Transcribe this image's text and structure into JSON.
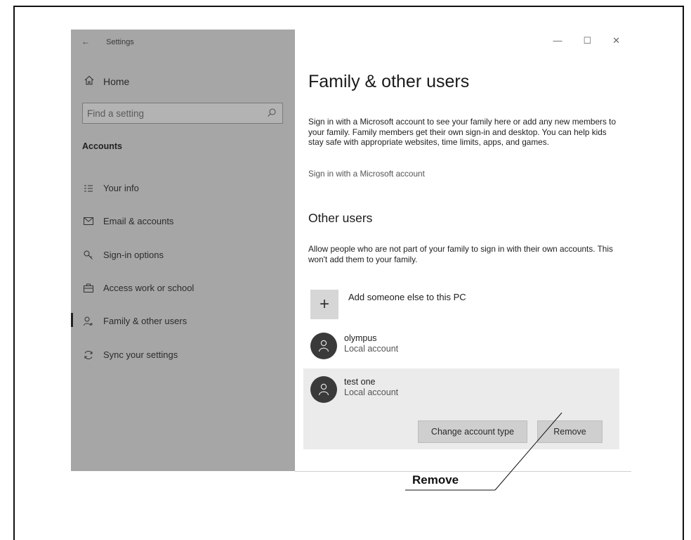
{
  "window": {
    "title": "Settings",
    "controls": {
      "minimize": "—",
      "maximize": "☐",
      "close": "✕"
    }
  },
  "sidebar": {
    "home_label": "Home",
    "search_placeholder": "Find a setting",
    "section_title": "Accounts",
    "items": [
      {
        "label": "Your info",
        "icon": "your-info-icon"
      },
      {
        "label": "Email & accounts",
        "icon": "email-icon"
      },
      {
        "label": "Sign-in options",
        "icon": "key-icon"
      },
      {
        "label": "Access work or school",
        "icon": "briefcase-icon"
      },
      {
        "label": "Family & other users",
        "icon": "person-add-icon",
        "active": true
      },
      {
        "label": "Sync your settings",
        "icon": "sync-icon"
      }
    ]
  },
  "main": {
    "title": "Family & other users",
    "description": "Sign in with a Microsoft account to see your family here or add any new members to your family. Family members get their own sign-in and desktop. You can help kids stay safe with appropriate websites, time limits, apps, and games.",
    "signin_link": "Sign in with a Microsoft account",
    "other_users_title": "Other users",
    "other_users_description": "Allow people who are not part of your family to sign in with their own accounts. This won't add them to your family.",
    "add_user_label": "Add someone else to this PC",
    "users": [
      {
        "name": "olympus",
        "type": "Local account"
      },
      {
        "name": "test one",
        "type": "Local account",
        "selected": true
      }
    ],
    "buttons": {
      "change_account_type": "Change account type",
      "remove": "Remove"
    }
  },
  "callout": {
    "label": "Remove"
  },
  "colors": {
    "sidebar_bg": "#a6a6a6",
    "content_bg": "#ffffff",
    "selected_card_bg": "#ebebeb",
    "button_bg": "#cfcfcf",
    "avatar_bg": "#3a3a3a"
  }
}
